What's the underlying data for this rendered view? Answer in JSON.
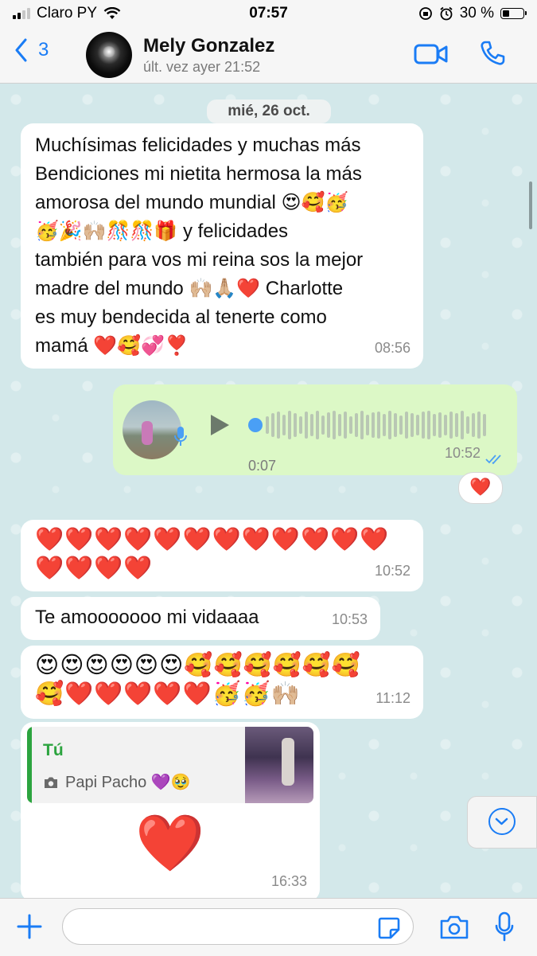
{
  "status_bar": {
    "carrier": "Claro PY",
    "time": "07:57",
    "battery": "30 %"
  },
  "header": {
    "back_count": "3",
    "contact_name": "Mely Gonzalez",
    "contact_status": "últ. vez ayer 21:52",
    "icons": [
      "chevron-left-icon",
      "video-call-icon",
      "phone-icon"
    ]
  },
  "chat": {
    "date_separator": "mié, 26 oct.",
    "messages": [
      {
        "type": "text",
        "direction": "in",
        "lines": [
          "Muchísimas felicidades y muchas más",
          "Bendiciones mi nietita hermosa la más",
          "amorosa del mundo mundial 😍🥰🥳",
          "🥳🎉🙌🏼🎊🎊🎁 y felicidades",
          "también para vos mi reina sos la mejor",
          "madre del mundo 🙌🏼🙏🏼❤️ Charlotte",
          "es muy  bendecida al tenerte como",
          "mamá ❤️🥰💞❣️"
        ],
        "time": "08:56"
      },
      {
        "type": "voice",
        "direction": "out",
        "duration": "0:07",
        "time": "10:52",
        "status": "read",
        "reaction": "❤️"
      },
      {
        "type": "text",
        "direction": "in",
        "lines": [
          "❤️❤️❤️❤️❤️❤️❤️❤️❤️❤️❤️❤️",
          "❤️❤️❤️❤️"
        ],
        "time": "10:52"
      },
      {
        "type": "text",
        "direction": "in",
        "lines": [
          "Te amooooooo mi vidaaaa"
        ],
        "time": "10:53"
      },
      {
        "type": "text",
        "direction": "in",
        "lines": [
          "😍😍😍😍😍😍🥰🥰🥰🥰🥰🥰",
          "🥰❤️❤️❤️❤️❤️🥳🥳🙌🏼"
        ],
        "time": "11:12"
      },
      {
        "type": "reply",
        "direction": "in",
        "quote_author": "Tú",
        "quote_caption": "Papi Pacho 💜🥹",
        "body": "❤️",
        "time": "16:33"
      }
    ]
  },
  "input_bar": {
    "placeholder": "",
    "icons": [
      "plus-icon",
      "sticker-icon",
      "camera-icon",
      "microphone-icon"
    ]
  },
  "colors": {
    "accent": "#1a7cf5",
    "outgoing_bubble": "#dcf8c6",
    "incoming_bubble": "#ffffff",
    "chat_background": "#d3e8ea",
    "quote_green": "#2ca43f",
    "heart_red": "#e0232d"
  }
}
